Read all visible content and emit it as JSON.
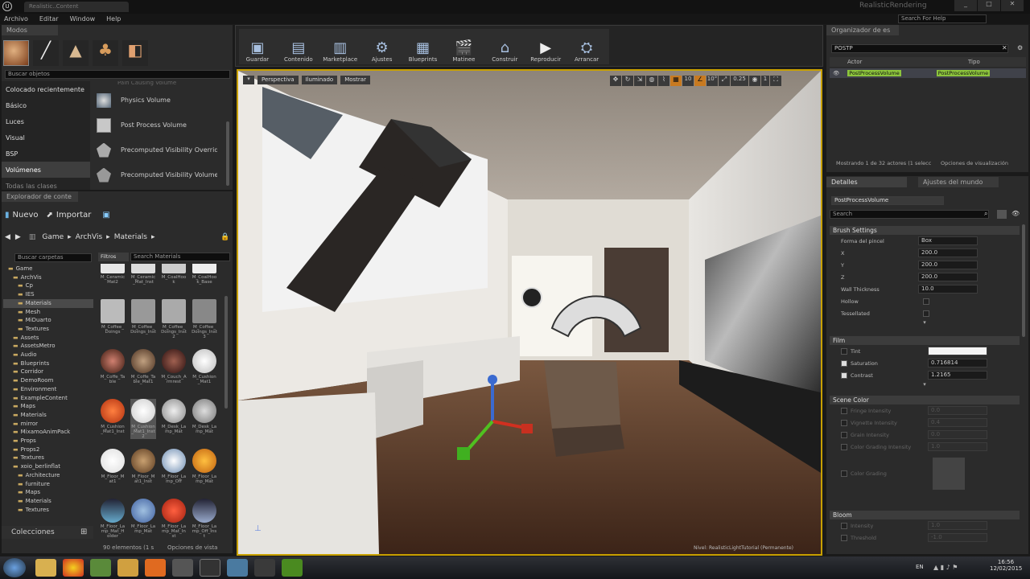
{
  "window": {
    "title": "RealisticRendering",
    "tab": "Realistic..Content",
    "search_placeholder": "Search For Help"
  },
  "menu": [
    "Archivo",
    "Editar",
    "Window",
    "Help"
  ],
  "modes": {
    "tab": "Modos",
    "search_placeholder": "Buscar objetos",
    "categories": [
      "Colocado recientemente",
      "Básico",
      "Luces",
      "Visual",
      "BSP",
      "Volúmenes",
      "Todas las clases"
    ],
    "items": [
      "Physics Volume",
      "Post Process Volume",
      "Precomputed Visibility Override Volume",
      "Precomputed Visibility Volume"
    ],
    "partial_top": "Pain Causing Volume"
  },
  "content_browser": {
    "tab": "Explorador de conte",
    "new": "Nuevo",
    "import": "Importar",
    "path": [
      "Game",
      "ArchVis",
      "Materials"
    ],
    "search_folders": "Buscar carpetas",
    "filters": "Filtros",
    "search_materials": "Search Materials",
    "tree": [
      "Game",
      "ArchVis",
      "Cp",
      "IES",
      "Materials",
      "Mesh",
      "MiDuarto",
      "Textures",
      "Assets",
      "AssetsMetro",
      "Audio",
      "Blueprints",
      "Corridor",
      "DemoRoom",
      "Environment",
      "ExampleContent",
      "Maps",
      "Materials",
      "mirror",
      "MixamoAnimPack",
      "Props",
      "Props2",
      "Textures",
      "xoio_berlinflat",
      "Architecture",
      "furniture",
      "Maps",
      "Materials",
      "Textures"
    ],
    "assets": [
      [
        "M_CeramicMat2",
        "M_Ceramic_Mat_Inst",
        "M_CoalHook",
        "M_CoalHook_Base"
      ],
      [
        "M_Coffee_Doings",
        "M_Coffee_Doings_Inst",
        "M_Coffee_Doings_Inst2",
        "M_Coffee_Doings_Inst3"
      ],
      [
        "M_Coffe_Table",
        "M_Coffe_Table_Mat1",
        "M_Couch_Armrest",
        "M_Cushion_Mat1"
      ],
      [
        "M_Cushion_Mat1_Inst",
        "M_Cushion_Mat1_Inst2",
        "M_Desk_Lamp_Mat",
        "M_Desk_Lamp_Mat"
      ],
      [
        "M_Floor_Mat1",
        "M_Floor_Mat1_Inst",
        "M_Floor_Lamp_Off",
        "M_Floor_Lamp_Mat"
      ],
      [
        "M_Floor_Lamp_Mat_Holder",
        "M_Floor_Lamp_Mat",
        "M_Floor_Lamp_Mat_Inst",
        "M_Floor_Lamp_Off_Inst"
      ]
    ],
    "count": "90 elementos (1 s",
    "view_options": "Opciones de vista"
  },
  "collections": "Colecciones",
  "toolbar": [
    "Guardar",
    "Contenido",
    "Marketplace",
    "Ajustes",
    "Blueprints",
    "Matinee",
    "Construir",
    "Reproducir",
    "Arrancar"
  ],
  "viewport": {
    "perspective": "Perspectiva",
    "lit": "Iluminado",
    "show": "Mostrar",
    "scale": "0.25",
    "camera": "1",
    "level_label": "Nivel: RealisticLightTutorial (Permanente)"
  },
  "outliner": {
    "tab": "Organizador de es",
    "search": "POSTP",
    "col_actor": "Actor",
    "col_type": "Tipo",
    "row_name": "PostProcessVolume",
    "row_type": "PostProcessVolume",
    "footer": "Mostrando 1 de 32 actores (1 selecc",
    "view_options": "Opciones de visualización"
  },
  "details": {
    "tab1": "Detalles",
    "tab2": "Ajustes del mundo",
    "object": "PostProcessVolume",
    "search": "Search",
    "brush_section": "Brush Settings",
    "brush_props": [
      {
        "label": "Forma del pincel",
        "value": "Box"
      },
      {
        "label": "X",
        "value": "200.0"
      },
      {
        "label": "Y",
        "value": "200.0"
      },
      {
        "label": "Z",
        "value": "200.0"
      },
      {
        "label": "Wall Thickness",
        "value": "10.0"
      },
      {
        "label": "Hollow",
        "value": ""
      },
      {
        "label": "Tessellated",
        "value": ""
      }
    ],
    "film_section": "Film",
    "film_props": [
      {
        "label": "Tint",
        "value": ""
      },
      {
        "label": "Saturation",
        "value": "0.716814"
      },
      {
        "label": "Contrast",
        "value": "1.2165"
      }
    ],
    "scene_section": "Scene Color",
    "scene_props": [
      "Fringe Intensity",
      "Vignette Intensity",
      "Grain Intensity",
      "Color Grading Intensity",
      "Color Grading"
    ],
    "scene_values": [
      "0.0",
      "0.4",
      "0.0",
      "1.0"
    ],
    "bloom_section": "Bloom",
    "bloom_props": [
      "Intensity",
      "Threshold"
    ],
    "bloom_values": [
      "1.0",
      "-1.0"
    ]
  },
  "taskbar": {
    "lang": "EN",
    "time": "16:56",
    "date": "12/02/2015"
  }
}
